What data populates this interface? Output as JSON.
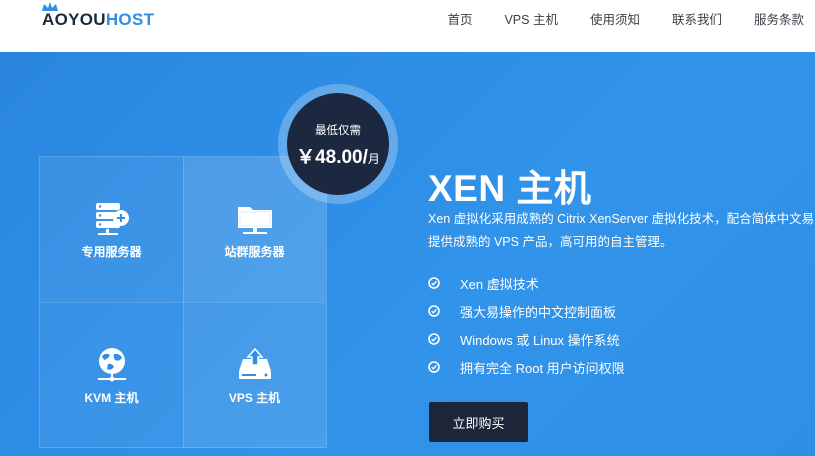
{
  "brand": {
    "logo_part1": "AOYOU",
    "logo_part2": "HOST"
  },
  "nav": {
    "items": [
      {
        "label": "首页"
      },
      {
        "label": "VPS 主机"
      },
      {
        "label": "使用须知"
      },
      {
        "label": "联系我们"
      },
      {
        "label": "服务条款"
      }
    ]
  },
  "products": [
    {
      "label": "专用服务器",
      "icon": "server-plus-icon"
    },
    {
      "label": "站群服务器",
      "icon": "folder-server-icon"
    },
    {
      "label": "KVM 主机",
      "icon": "globe-network-icon"
    },
    {
      "label": "VPS 主机",
      "icon": "upload-drive-icon"
    }
  ],
  "price_badge": {
    "label": "最低仅需",
    "price": "￥48.00/",
    "unit": "月"
  },
  "hero": {
    "title": "XEN 主机",
    "description_line1": "Xen 虚拟化采用成熟的 Citrix XenServer 虚拟化技术，配合简体中文易",
    "description_line2": "提供成熟的 VPS 产品，高可用的自主管理。",
    "features": [
      "Xen 虚拟技术",
      "强大易操作的中文控制面板",
      "Windows 或 Linux 操作系统",
      "拥有完全 Root 用户访问权限"
    ],
    "buy_label": "立即购买"
  },
  "colors": {
    "accent": "#2f8fe6",
    "dark": "#1c2638",
    "badge": "#1c2840",
    "header_bg": "#ffffff"
  }
}
